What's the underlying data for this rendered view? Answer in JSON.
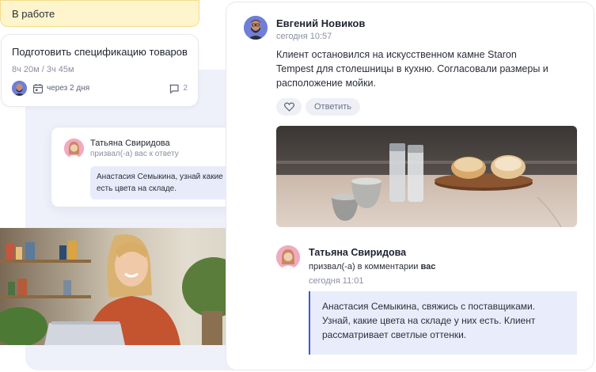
{
  "status": {
    "label": "В работе"
  },
  "task": {
    "title": "Подготовить спецификацию товаров",
    "time": "8ч 20м / 3ч 45м",
    "due": "через 2 дня",
    "comments": "2"
  },
  "mention_popup": {
    "author": "Татьяна Свиридова",
    "action": "призвал(-а) вас к ответу",
    "text": "Анастасия Семыкина, узнай какие есть цвета на складе."
  },
  "chat": {
    "message1": {
      "author": "Евгений Новиков",
      "time": "сегодня 10:57",
      "text": "Клиент остановился на искусственном камне Staron Tempest для столешницы в кухню. Согласовали размеры и расположение мойки.",
      "reply_label": "Ответить"
    },
    "message2": {
      "author": "Татьяна Свиридова",
      "action_prefix": "призвал(-а) в комментарии",
      "action_target": "вас",
      "time": "сегодня 11:01",
      "quote": "Анастасия Семыкина, свяжись с поставщиками. Узнай, какие цвета на складе у них есть. Клиент рассматривает светлые оттенки."
    }
  },
  "colors": {
    "accent": "#3f58d6",
    "status_bg": "#fff5cc",
    "quote_bg": "#e9edfb",
    "panel_bg": "#eef0fa"
  },
  "icons": [
    "calendar-icon",
    "comment-icon",
    "heart-icon"
  ]
}
